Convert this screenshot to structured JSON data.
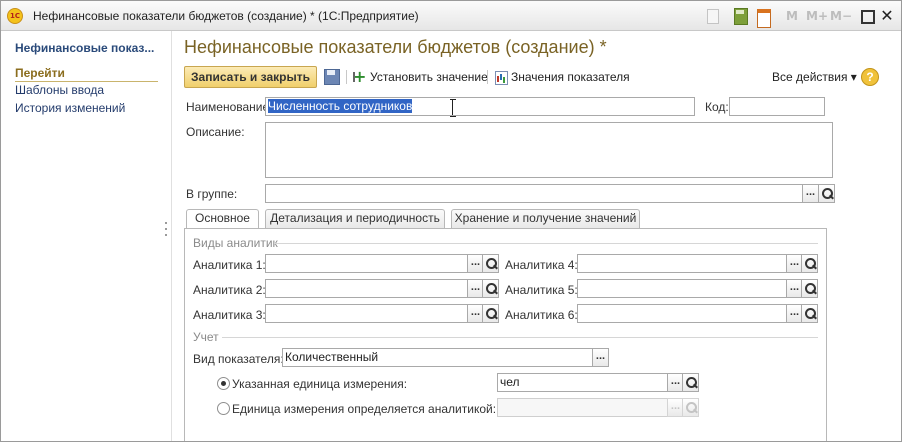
{
  "window": {
    "title": "Нефинансовые показатели бюджетов (создание) * (1С:Предприятие)",
    "logo": "1С",
    "m_label": "M",
    "m_plus_label": "M+",
    "m_minus_label": "M−",
    "close_glyph": "✕"
  },
  "sidebar": {
    "header": "Нефинансовые показ...",
    "section_title": "Перейти",
    "links": [
      "Шаблоны ввода",
      "История изменений"
    ]
  },
  "form": {
    "title": "Нефинансовые показатели бюджетов (создание) *",
    "toolbar": {
      "save_close": "Записать и закрыть",
      "set_value": "Установить значение",
      "indicator_values": "Значения показателя",
      "all_actions": "Все действия ▾",
      "help": "?"
    },
    "name_label": "Наименование:",
    "name_value": "Численность сотрудников",
    "code_label": "Код:",
    "code_value": "",
    "description_label": "Описание:",
    "group_label": "В группе:",
    "group_value": "",
    "tabs": [
      "Основное",
      "Детализация и периодичность",
      "Хранение и получение значений"
    ],
    "active_tab": 0,
    "analytics_group_title": "Виды аналитик",
    "analytics": [
      {
        "label": "Аналитика 1:",
        "value": ""
      },
      {
        "label": "Аналитика 2:",
        "value": ""
      },
      {
        "label": "Аналитика 3:",
        "value": ""
      },
      {
        "label": "Аналитика 4:",
        "value": ""
      },
      {
        "label": "Аналитика 5:",
        "value": ""
      },
      {
        "label": "Аналитика 6:",
        "value": ""
      }
    ],
    "accounting_group_title": "Учет",
    "indicator_type_label": "Вид показателя:",
    "indicator_type_value": "Количественный",
    "unit_radio_label": "Указанная единица измерения:",
    "unit_radio_checked": true,
    "unit_value": "чел",
    "unit_by_analytics_label": "Единица измерения определяется аналитикой:",
    "unit_by_analytics_checked": false,
    "unit_by_analytics_value": "",
    "dots_glyph": "..."
  }
}
